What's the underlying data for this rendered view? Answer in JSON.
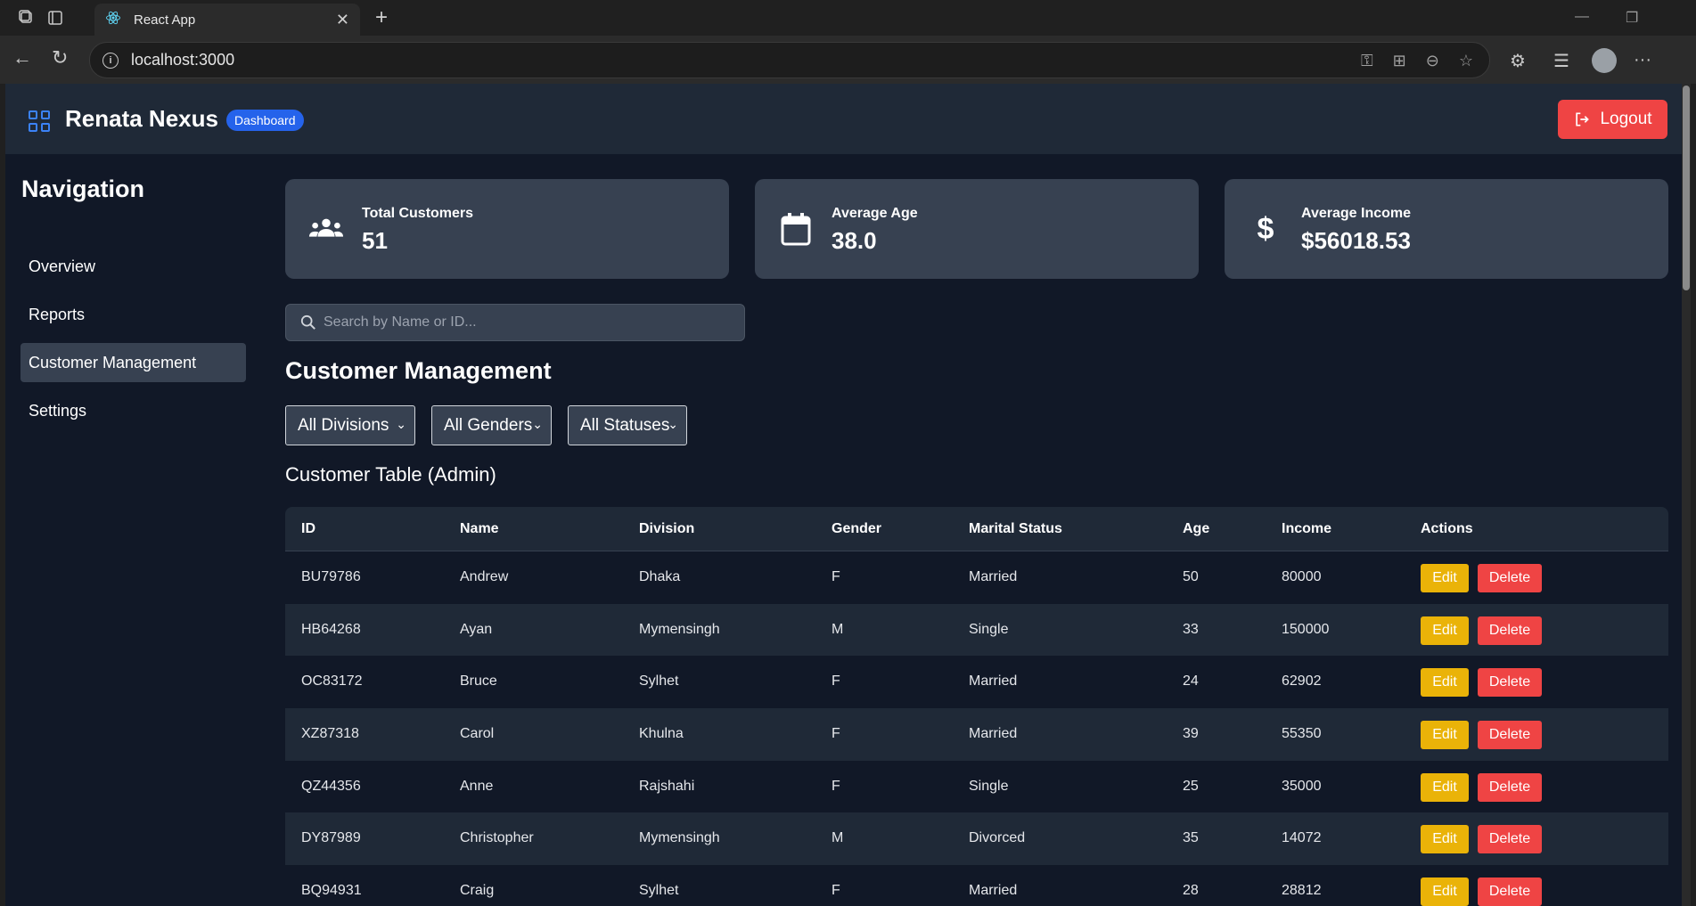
{
  "browser": {
    "tab_title": "React App",
    "url": "localhost:3000"
  },
  "header": {
    "brand": "Renata Nexus",
    "badge": "Dashboard",
    "logout_label": "Logout"
  },
  "sidebar": {
    "title": "Navigation",
    "items": [
      {
        "label": "Overview"
      },
      {
        "label": "Reports"
      },
      {
        "label": "Customer Management"
      },
      {
        "label": "Settings"
      }
    ]
  },
  "stats": [
    {
      "label": "Total Customers",
      "value": "51",
      "icon": "users-icon"
    },
    {
      "label": "Average Age",
      "value": "38.0",
      "icon": "calendar-icon"
    },
    {
      "label": "Average Income",
      "value": "$56018.53",
      "icon": "dollar-icon"
    }
  ],
  "search": {
    "placeholder": "Search by Name or ID..."
  },
  "section_title": "Customer Management",
  "filters": [
    {
      "label": "All Divisions"
    },
    {
      "label": "All Genders"
    },
    {
      "label": "All Statuses"
    }
  ],
  "table": {
    "title": "Customer Table (Admin)",
    "columns": [
      "ID",
      "Name",
      "Division",
      "Gender",
      "Marital Status",
      "Age",
      "Income",
      "Actions"
    ],
    "edit_label": "Edit",
    "delete_label": "Delete",
    "rows": [
      [
        "BU79786",
        "Andrew",
        "Dhaka",
        "F",
        "Married",
        "50",
        "80000"
      ],
      [
        "HB64268",
        "Ayan",
        "Mymensingh",
        "M",
        "Single",
        "33",
        "150000"
      ],
      [
        "OC83172",
        "Bruce",
        "Sylhet",
        "F",
        "Married",
        "24",
        "62902"
      ],
      [
        "XZ87318",
        "Carol",
        "Khulna",
        "F",
        "Married",
        "39",
        "55350"
      ],
      [
        "QZ44356",
        "Anne",
        "Rajshahi",
        "F",
        "Single",
        "25",
        "35000"
      ],
      [
        "DY87989",
        "Christopher",
        "Mymensingh",
        "M",
        "Divorced",
        "35",
        "14072"
      ],
      [
        "BQ94931",
        "Craig",
        "Sylhet",
        "F",
        "Married",
        "28",
        "28812"
      ]
    ]
  },
  "colors": {
    "background": "#111827",
    "panel": "#1f2937",
    "card": "#374151",
    "accent": "#2563eb",
    "danger": "#ef4444",
    "warning": "#eab308"
  }
}
